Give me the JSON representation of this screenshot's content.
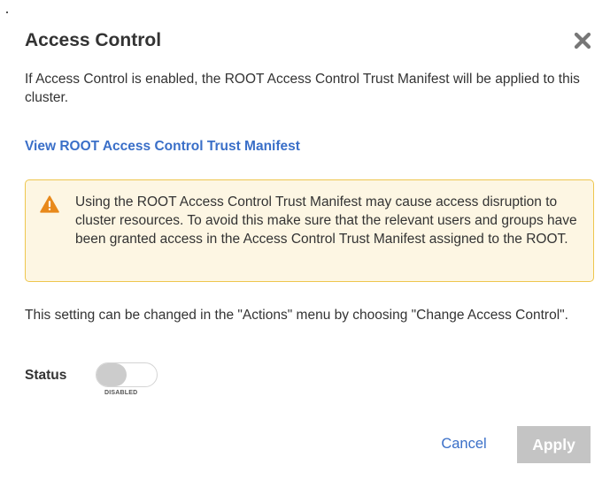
{
  "dialog": {
    "title": "Access Control",
    "close_icon": "close-icon",
    "intro_text": "If Access Control is enabled, the ROOT Access Control Trust Manifest will be applied to this cluster.",
    "manifest_link": "View ROOT Access Control Trust Manifest",
    "warning": {
      "icon": "warning-icon",
      "text": "Using the ROOT Access Control Trust Manifest may cause access disruption to cluster resources. To avoid this make sure that the relevant users and groups have been granted access in the Access Control Trust Manifest assigned to the ROOT."
    },
    "note_text": "This setting can be changed in the \"Actions\" menu by choosing \"Change Access Control\".",
    "status": {
      "label": "Status",
      "toggle_state": "DISABLED",
      "enabled": false
    },
    "buttons": {
      "cancel_label": "Cancel",
      "apply_label": "Apply",
      "apply_enabled": false
    }
  },
  "colors": {
    "link": "#3a6fc8",
    "warning_bg": "#fdf6e3",
    "warning_border": "#eec64e",
    "warning_icon": "#e8891b",
    "apply_disabled_bg": "#c4c4c4",
    "toggle_knob": "#cccccc",
    "text": "#333333"
  }
}
